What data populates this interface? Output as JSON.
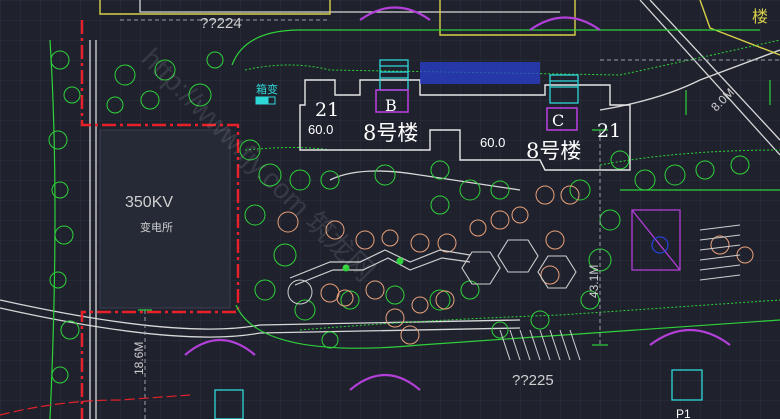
{
  "drawing": {
    "colors": {
      "background": "#1f222d",
      "grid": "#2e3445",
      "tree_green": "#2fd23a",
      "road_white": "#d8d8d8",
      "boundary_red": "#e8202a",
      "building_yellow": "#d8d04a",
      "purple": "#b23fd8",
      "cyan": "#2fd8d8",
      "blue": "#2a3fd0",
      "orange": "#e8a07a",
      "dashed_gray": "#9aa0aa"
    },
    "labels": {
      "top_code": "??224",
      "bottom_code": "??225",
      "box_transformer": "箱变",
      "substation_voltage": "350KV",
      "substation_name": "变电所",
      "unit_b_floors": "21",
      "unit_b_letter": "B",
      "unit_b_height": "60.0",
      "unit_c_floors": "21",
      "unit_c_letter": "C",
      "unit_c_height": "60.0",
      "building_name_left": "8号楼",
      "building_name_right": "8号楼",
      "dim_8m": "8.0M",
      "dim_43m": "43.1M",
      "dim_18m": "18.6M",
      "top_right_char": "楼",
      "bottom_right_char": "P1"
    },
    "watermark": "http://www.fjy.com 筑龙网"
  }
}
